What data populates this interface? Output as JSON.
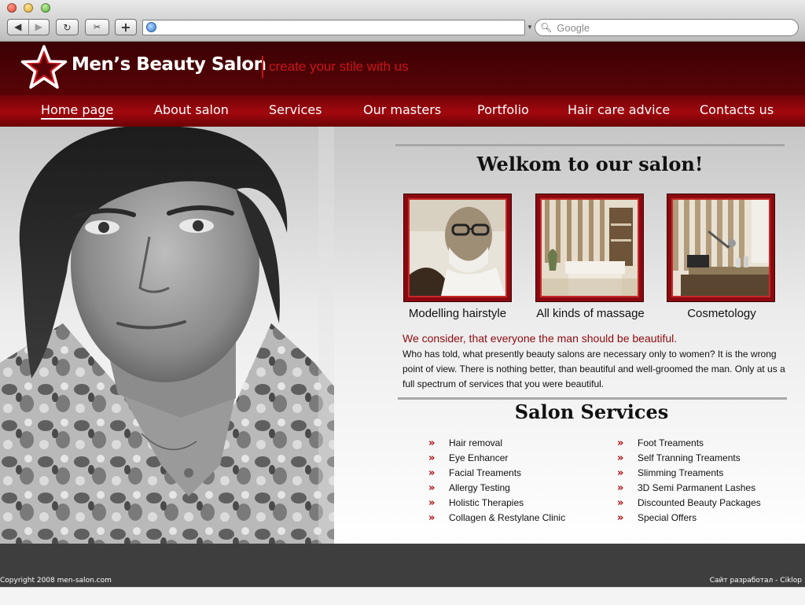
{
  "browser": {
    "back_icon": "◀",
    "forward_icon": "▶",
    "reload_icon": "↻",
    "add_icon": "+",
    "snapback_icon": "✂",
    "search_placeholder": "Google",
    "url_value": ""
  },
  "header": {
    "title": "Men’s Beauty Salon",
    "tagline": "create your stile with us"
  },
  "nav": {
    "items": [
      {
        "label": "Home page"
      },
      {
        "label": "About salon"
      },
      {
        "label": "Services"
      },
      {
        "label": "Our masters"
      },
      {
        "label": "Portfolio"
      },
      {
        "label": "Hair care advice"
      },
      {
        "label": "Contacts us"
      }
    ]
  },
  "welcome": {
    "title": "Welkom to our salon!",
    "features": [
      {
        "caption": "Modelling hairstyle"
      },
      {
        "caption": "All kinds of massage"
      },
      {
        "caption": "Cosmetology"
      }
    ],
    "lead": "We consider, that everyone the man should be beautiful.",
    "body": "Who has told, what presently beauty salons are necessary only to women? It is the wrong point of view. There is nothing better, than beautiful and well-groomed the man. Only at us a full spectrum of services that you were beautiful."
  },
  "services": {
    "title": "Salon Services",
    "arrow": "»",
    "left": [
      "Hair removal",
      "Eye Enhancer",
      "Facial Treaments",
      "Allergy Testing",
      "Holistic Therapies",
      "Collagen & Restylane Clinic"
    ],
    "right": [
      "Foot Treaments",
      "Self Tranning Treaments",
      "Slimming Treaments",
      "3D Semi Parmanent Lashes",
      "Discounted Beauty Packages",
      "Special Offers"
    ]
  },
  "footer": {
    "copyright": "Copyright 2008 men-salon.com",
    "credit": "Сайт разработал - Ciklop"
  },
  "colors": {
    "header_dark": "#3a0204",
    "nav_red": "#a2080e",
    "accent_red": "#c8141c",
    "footer_gray": "#3e3e3e"
  }
}
